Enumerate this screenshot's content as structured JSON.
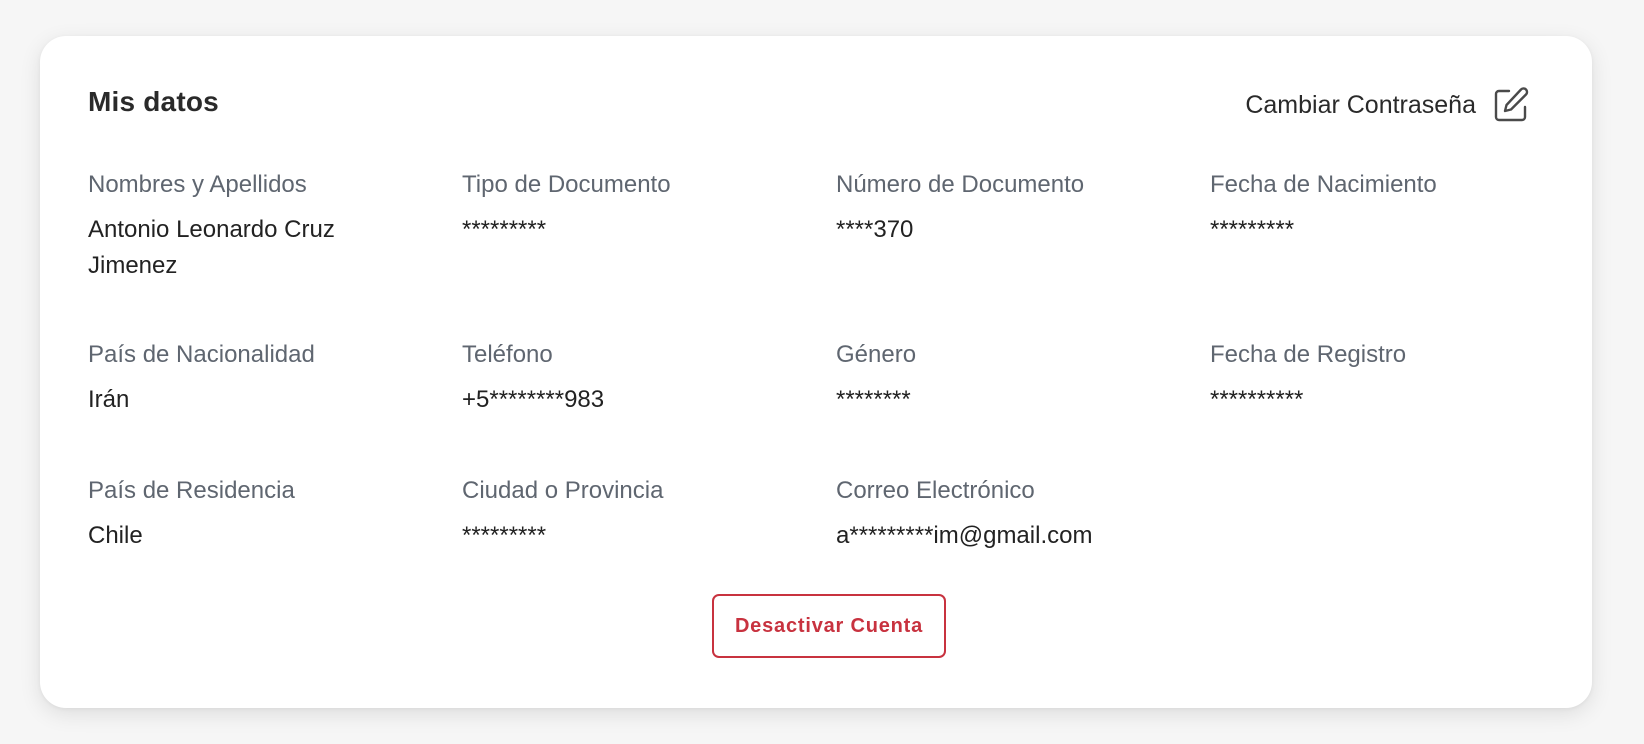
{
  "card": {
    "title": "Mis datos",
    "change_password_label": "Cambiar Contraseña",
    "edit_icon": "edit-pencil-square-icon",
    "deactivate_label": "Desactivar Cuenta",
    "accent_color": "#c8323f"
  },
  "fields": [
    {
      "label": "Nombres y Apellidos",
      "value": "Antonio Leonardo Cruz Jimenez"
    },
    {
      "label": "Tipo de Documento",
      "value": "*********"
    },
    {
      "label": "Número de Documento",
      "value": "****370"
    },
    {
      "label": "Fecha de Nacimiento",
      "value": "*********"
    },
    {
      "label": "País de Nacionalidad",
      "value": "Irán"
    },
    {
      "label": "Teléfono",
      "value": "+5********983"
    },
    {
      "label": "Género",
      "value": "********"
    },
    {
      "label": "Fecha de Registro",
      "value": "**********"
    },
    {
      "label": "País de Residencia",
      "value": "Chile"
    },
    {
      "label": "Ciudad o Provincia",
      "value": "*********"
    },
    {
      "label": "Correo Electrónico",
      "value": "a*********im@gmail.com"
    }
  ]
}
